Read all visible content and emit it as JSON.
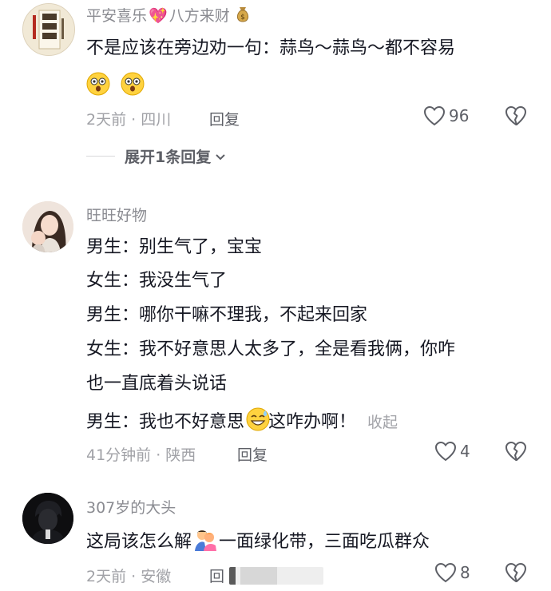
{
  "comments": [
    {
      "username_parts": [
        "平安喜乐",
        "八方来财"
      ],
      "lines": [
        "不是应该在旁边劝一句：蒜鸟～蒜鸟～都不容易"
      ],
      "meta": "2天前 · 四川",
      "reply_label": "回复",
      "likes": "96",
      "expand_label": "展开1条回复"
    },
    {
      "username": "旺旺好物",
      "lines": [
        "男生：别生气了，宝宝",
        "女生：我没生气了",
        "男生：哪你干嘛不理我，不起来回家",
        "女生：我不好意思人太多了，全是看我俩，你咋",
        "也一直底着头说话"
      ],
      "last_line_before": "男生：我也不好意思",
      "last_line_after": "这咋办啊！",
      "collapse_label": "收起",
      "meta": "41分钟前 · 陕西",
      "reply_label": "回复",
      "likes": "4"
    },
    {
      "username": "307岁的大头",
      "line_before": "这局该怎么解",
      "line_after": "一面绿化带，三面吃瓜群众",
      "meta": "2天前 · 安徽",
      "reply_label": "回",
      "likes": "8"
    }
  ]
}
